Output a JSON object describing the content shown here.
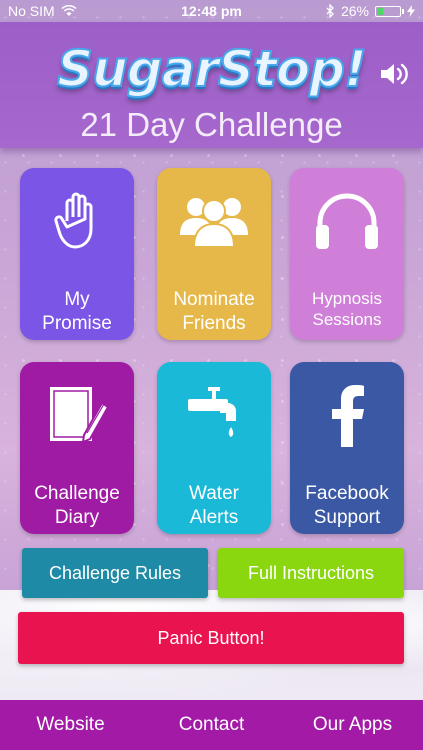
{
  "status_bar": {
    "carrier": "No SIM",
    "time": "12:48 pm",
    "battery": "26%",
    "icons": [
      "wifi-icon",
      "bluetooth-icon",
      "battery-icon",
      "charging-icon"
    ]
  },
  "header": {
    "logo_text": "SugarStop!",
    "subtitle": "21 Day Challenge",
    "sound_icon": "speaker-icon"
  },
  "tiles": [
    {
      "label_1": "My",
      "label_2": "Promise",
      "icon": "raised-hand-icon",
      "color": "#7b55e6"
    },
    {
      "label_1": "Nominate",
      "label_2": "Friends",
      "icon": "group-people-icon",
      "color": "#e6b84a"
    },
    {
      "label_1": "Hypnosis",
      "label_2": "Sessions",
      "icon": "headphones-icon",
      "color": "#cf7fd8"
    },
    {
      "label_1": "Challenge",
      "label_2": "Diary",
      "icon": "notebook-pen-icon",
      "color": "#a01ba3"
    },
    {
      "label_1": "Water",
      "label_2": "Alerts",
      "icon": "water-tap-icon",
      "color": "#1ab9d8"
    },
    {
      "label_1": "Facebook",
      "label_2": "Support",
      "icon": "facebook-icon",
      "color": "#3a58a4"
    }
  ],
  "buttons": {
    "rules": "Challenge Rules",
    "instructions": "Full Instructions",
    "panic": "Panic Button!"
  },
  "colors": {
    "rules": "#1f8aa6",
    "instructions": "#8ad60f",
    "panic": "#e8134f",
    "bottom_bar": "#a21aa6"
  },
  "bottom_nav": {
    "website": "Website",
    "contact": "Contact",
    "apps": "Our Apps"
  }
}
